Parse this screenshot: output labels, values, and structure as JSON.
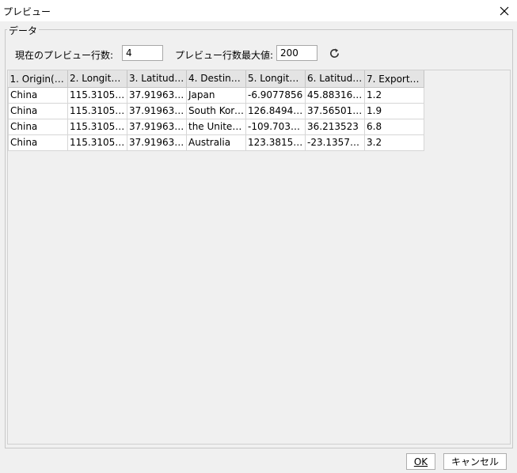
{
  "window": {
    "title": "プレビュー",
    "close_icon": "close-icon"
  },
  "group": {
    "legend": "データ"
  },
  "options": {
    "current_rows_label": "現在のプレビュー行数:",
    "current_rows_value": "4",
    "max_rows_label": "プレビュー行数最大値:",
    "max_rows_value": "200",
    "refresh_icon": "refresh-icon"
  },
  "table": {
    "columns": [
      "1. Origin(文...",
      "2. Longitud...",
      "3. Latitude_...",
      "4. Destinati...",
      "5. Longitud...",
      "6. Latitude_...",
      "7. Export(文..."
    ],
    "rows": [
      [
        "China",
        "115.310547",
        "37.9196356",
        "Japan",
        "-6.9077856",
        "45.8831684",
        "1.2"
      ],
      [
        "China",
        "115.310547",
        "37.9196356",
        "South Korea",
        "126.84946...",
        "37.5650172",
        "1.9"
      ],
      [
        "China",
        "115.310547",
        "37.9196356",
        "the United ...",
        "-109.70354...",
        "36.213523",
        "6.8"
      ],
      [
        "China",
        "115.310547",
        "37.9196356",
        "Australia",
        "123.38154...",
        "-23.1357349",
        "3.2"
      ]
    ]
  },
  "buttons": {
    "ok": "OK",
    "cancel": "キャンセル"
  }
}
